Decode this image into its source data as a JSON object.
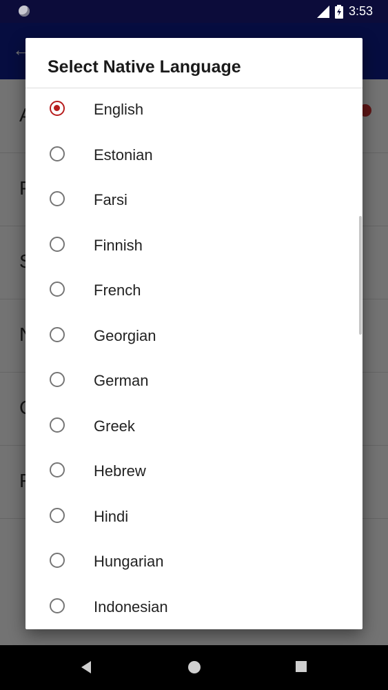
{
  "status_bar": {
    "time": "3:53"
  },
  "dialog": {
    "title": "Select Native Language",
    "options": [
      {
        "label": "English",
        "selected": true
      },
      {
        "label": "Estonian",
        "selected": false
      },
      {
        "label": "Farsi",
        "selected": false
      },
      {
        "label": "Finnish",
        "selected": false
      },
      {
        "label": "French",
        "selected": false
      },
      {
        "label": "Georgian",
        "selected": false
      },
      {
        "label": "German",
        "selected": false
      },
      {
        "label": "Greek",
        "selected": false
      },
      {
        "label": "Hebrew",
        "selected": false
      },
      {
        "label": "Hindi",
        "selected": false
      },
      {
        "label": "Hungarian",
        "selected": false
      },
      {
        "label": "Indonesian",
        "selected": false
      }
    ]
  },
  "background": {
    "row_letters": [
      "A",
      "P",
      "S",
      "N",
      "C",
      "F"
    ]
  },
  "colors": {
    "status_bar": "#0c0c3a",
    "app_bar": "#0e1e8f",
    "radio_selected": "#b71c1c",
    "radio_unselected": "#757575"
  },
  "icons": {
    "status": [
      "notification-dot-icon",
      "signal-icon",
      "battery-charging-icon"
    ],
    "nav": [
      "back-triangle-icon",
      "home-circle-icon",
      "recents-square-icon"
    ]
  }
}
